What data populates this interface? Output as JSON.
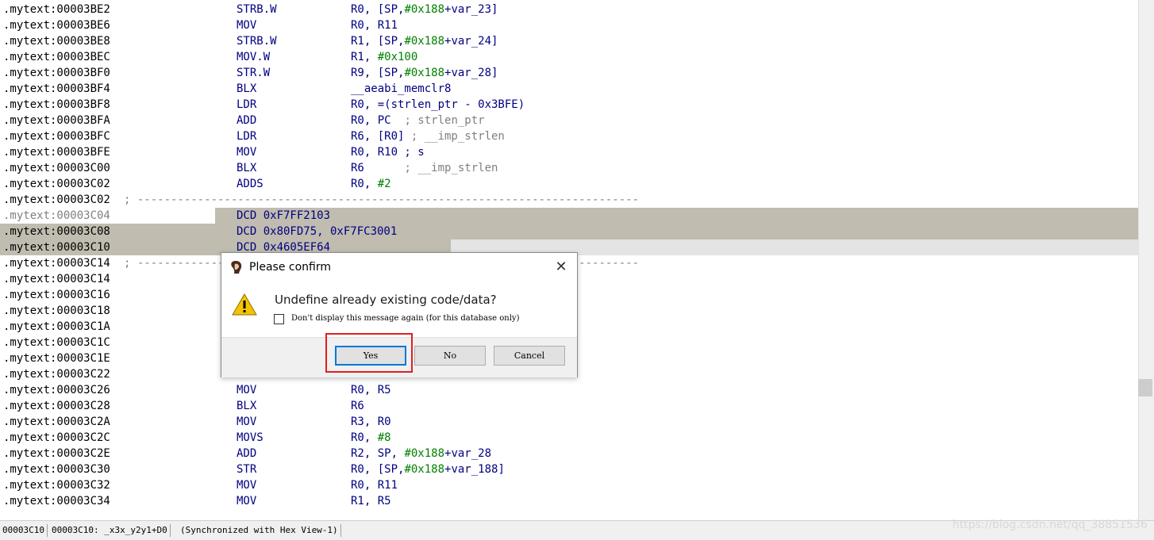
{
  "listing": [
    {
      "addr": ".mytext:00003BE2",
      "mn": "STRB.W",
      "op": [
        {
          "t": "R0, [SP,"
        },
        {
          "t": "#0x188",
          "c": "num"
        },
        {
          "t": "+var_23]"
        }
      ]
    },
    {
      "addr": ".mytext:00003BE6",
      "mn": "MOV",
      "op": [
        {
          "t": "R0, R11"
        }
      ]
    },
    {
      "addr": ".mytext:00003BE8",
      "mn": "STRB.W",
      "op": [
        {
          "t": "R1, [SP,"
        },
        {
          "t": "#0x188",
          "c": "num"
        },
        {
          "t": "+var_24]"
        }
      ]
    },
    {
      "addr": ".mytext:00003BEC",
      "mn": "MOV.W",
      "op": [
        {
          "t": "R1, "
        },
        {
          "t": "#0x100",
          "c": "num"
        }
      ]
    },
    {
      "addr": ".mytext:00003BF0",
      "mn": "STR.W",
      "op": [
        {
          "t": "R9, [SP,"
        },
        {
          "t": "#0x188",
          "c": "num"
        },
        {
          "t": "+var_28]"
        }
      ]
    },
    {
      "addr": ".mytext:00003BF4",
      "mn": "BLX",
      "op": [
        {
          "t": "__aeabi_memclr8"
        }
      ]
    },
    {
      "addr": ".mytext:00003BF8",
      "mn": "LDR",
      "op": [
        {
          "t": "R0, =(strlen_ptr - 0x3BFE)"
        }
      ]
    },
    {
      "addr": ".mytext:00003BFA",
      "mn": "ADD",
      "op": [
        {
          "t": "R0, PC  "
        },
        {
          "t": "; strlen_ptr",
          "c": "cmt"
        }
      ]
    },
    {
      "addr": ".mytext:00003BFC",
      "mn": "LDR",
      "op": [
        {
          "t": "R6, [R0] "
        },
        {
          "t": "; __imp_strlen",
          "c": "cmt"
        }
      ]
    },
    {
      "addr": ".mytext:00003BFE",
      "mn": "MOV",
      "op": [
        {
          "t": "R0, R10 ; s"
        }
      ]
    },
    {
      "addr": ".mytext:00003C00",
      "mn": "BLX",
      "op": [
        {
          "t": "R6      "
        },
        {
          "t": "; __imp_strlen",
          "c": "cmt"
        }
      ]
    },
    {
      "addr": ".mytext:00003C02",
      "mn": "ADDS",
      "op": [
        {
          "t": "R0, "
        },
        {
          "t": "#2",
          "c": "num"
        }
      ]
    },
    {
      "addr": ".mytext:00003C02",
      "sep": "; ---------------------------------------------------------------------------"
    },
    {
      "addr": ".mytext:00003C04",
      "mn": "DCD 0xF7FF2103",
      "op": [],
      "hl": "c04"
    },
    {
      "addr": ".mytext:00003C08",
      "mn": "DCD 0x80FD75, 0xF7FC3001",
      "op": [],
      "hl": "c08"
    },
    {
      "addr": ".mytext:00003C10",
      "mn": "DCD 0x4605EF64",
      "op": [],
      "hl": "c10"
    },
    {
      "addr": ".mytext:00003C14",
      "sep": "; ---------------------------------------------------------------------------"
    },
    {
      "addr": ".mytext:00003C14",
      "mn": "",
      "op": []
    },
    {
      "addr": ".mytext:00003C16",
      "mn": "",
      "op": []
    },
    {
      "addr": ".mytext:00003C18",
      "mn": "",
      "op": []
    },
    {
      "addr": ".mytext:00003C1A",
      "mn": "",
      "op": []
    },
    {
      "addr": ".mytext:00003C1C",
      "mn": "",
      "op": []
    },
    {
      "addr": ".mytext:00003C1E",
      "mn": "",
      "op": []
    },
    {
      "addr": ".mytext:00003C22",
      "mn": "",
      "op": []
    },
    {
      "addr": ".mytext:00003C26",
      "mn": "MOV",
      "op": [
        {
          "t": "R0, R5"
        }
      ]
    },
    {
      "addr": ".mytext:00003C28",
      "mn": "BLX",
      "op": [
        {
          "t": "R6"
        }
      ]
    },
    {
      "addr": ".mytext:00003C2A",
      "mn": "MOV",
      "op": [
        {
          "t": "R3, R0"
        }
      ]
    },
    {
      "addr": ".mytext:00003C2C",
      "mn": "MOVS",
      "op": [
        {
          "t": "R0, "
        },
        {
          "t": "#8",
          "c": "num"
        }
      ]
    },
    {
      "addr": ".mytext:00003C2E",
      "mn": "ADD",
      "op": [
        {
          "t": "R2, SP, "
        },
        {
          "t": "#0x188",
          "c": "num"
        },
        {
          "t": "+var_28"
        }
      ]
    },
    {
      "addr": ".mytext:00003C30",
      "mn": "STR",
      "op": [
        {
          "t": "R0, [SP,"
        },
        {
          "t": "#0x188",
          "c": "num"
        },
        {
          "t": "+var_188]"
        }
      ]
    },
    {
      "addr": ".mytext:00003C32",
      "mn": "MOV",
      "op": [
        {
          "t": "R0, R11"
        }
      ]
    },
    {
      "addr": ".mytext:00003C34",
      "mn": "MOV",
      "op": [
        {
          "t": "R1, R5"
        }
      ]
    }
  ],
  "status": {
    "cursor_addr": "00003C10",
    "location": "00003C10: _x3x_y2y1+D0",
    "sync": "(Synchronized with Hex View-1)"
  },
  "watermark": "https://blog.csdn.net/qq_38851536",
  "dialog": {
    "title": "Please confirm",
    "message": "Undefine already existing code/data?",
    "checkbox_label": "Don't display this message again (for this database only)",
    "checkbox_checked": false,
    "buttons": {
      "yes": "Yes",
      "no": "No",
      "cancel": "Cancel"
    },
    "icons": {
      "app": "ida-app-icon",
      "warning": "warning-icon",
      "close": "close-icon"
    }
  },
  "colors": {
    "listing_text": "#000080",
    "immediate": "#008000",
    "comment": "#808080",
    "selection": "#c0bcb0",
    "highlight_line": "#e4e4e4",
    "annotation_box": "#e02020",
    "default_button_border": "#0078d7"
  }
}
